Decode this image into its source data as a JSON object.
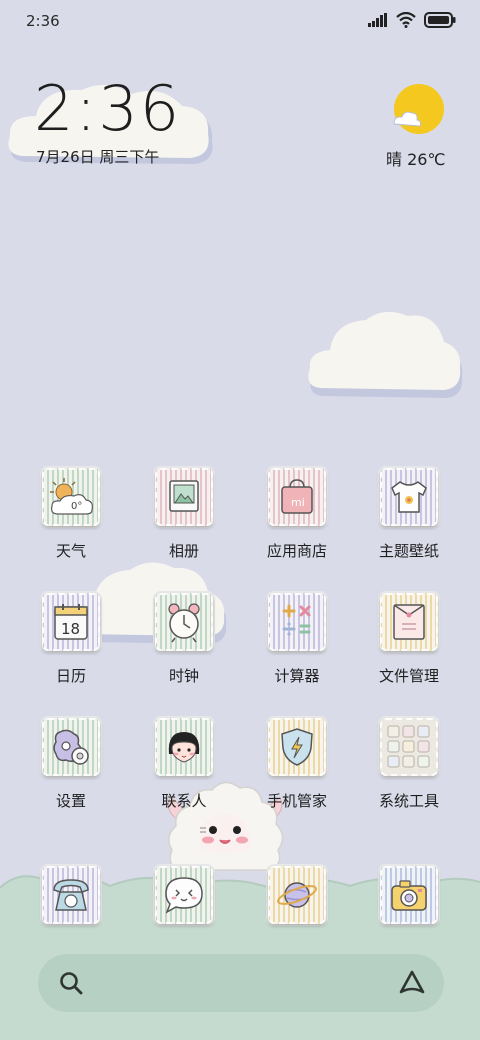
{
  "status_bar": {
    "time": "2:36"
  },
  "clock_widget": {
    "time": "2:36",
    "date": "7月26日 周三下午"
  },
  "weather_widget": {
    "text": "晴 26℃"
  },
  "apps": [
    {
      "label": "天气"
    },
    {
      "label": "相册"
    },
    {
      "label": "应用商店"
    },
    {
      "label": "主题壁纸"
    },
    {
      "label": "日历"
    },
    {
      "label": "时钟"
    },
    {
      "label": "计算器"
    },
    {
      "label": "文件管理"
    },
    {
      "label": "设置"
    },
    {
      "label": "联系人"
    },
    {
      "label": "手机管家"
    },
    {
      "label": "系统工具"
    }
  ],
  "icon_text": {
    "weather_temp": "0°",
    "calendar_day": "18",
    "store_mark": "mi"
  },
  "dock": [
    "phone-icon",
    "messages-icon",
    "browser-icon",
    "camera-icon"
  ],
  "colors": {
    "background": "#d9dbe9",
    "ground": "#c6dbd0",
    "sun": "#f4c81f"
  }
}
